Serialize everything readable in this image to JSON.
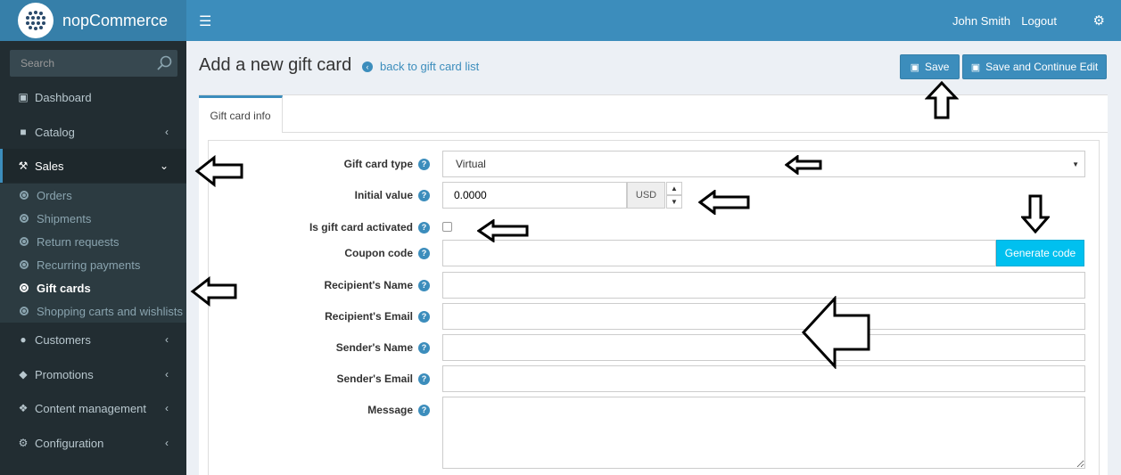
{
  "app": {
    "name": "nopCommerce"
  },
  "header": {
    "user_name": "John Smith",
    "logout_label": "Logout"
  },
  "sidebar": {
    "search_placeholder": "Search",
    "items": [
      {
        "label": "Dashboard",
        "icon": "monitor-icon"
      },
      {
        "label": "Catalog",
        "icon": "book-icon"
      },
      {
        "label": "Sales",
        "icon": "cart-icon"
      },
      {
        "label": "Customers",
        "icon": "user-icon"
      },
      {
        "label": "Promotions",
        "icon": "tag-icon"
      },
      {
        "label": "Content management",
        "icon": "cubes-icon"
      },
      {
        "label": "Configuration",
        "icon": "gears-icon"
      }
    ],
    "sales_submenu": [
      "Orders",
      "Shipments",
      "Return requests",
      "Recurring payments",
      "Gift cards",
      "Shopping carts and wishlists"
    ]
  },
  "page": {
    "title": "Add a new gift card",
    "back_link": "back to gift card list",
    "save_label": "Save",
    "save_continue_label": "Save and Continue Edit"
  },
  "tabs": {
    "info": "Gift card info"
  },
  "form": {
    "gift_card_type_label": "Gift card type",
    "gift_card_type_value": "Virtual",
    "initial_value_label": "Initial value",
    "initial_value": "0.0000",
    "currency": "USD",
    "activated_label": "Is gift card activated",
    "coupon_code_label": "Coupon code",
    "generate_code_label": "Generate code",
    "recipient_name_label": "Recipient's Name",
    "recipient_email_label": "Recipient's Email",
    "sender_name_label": "Sender's Name",
    "sender_email_label": "Sender's Email",
    "message_label": "Message"
  },
  "colors": {
    "header": "#3c8dbc",
    "sidebar": "#222d32",
    "accent": "#00c0ef"
  }
}
